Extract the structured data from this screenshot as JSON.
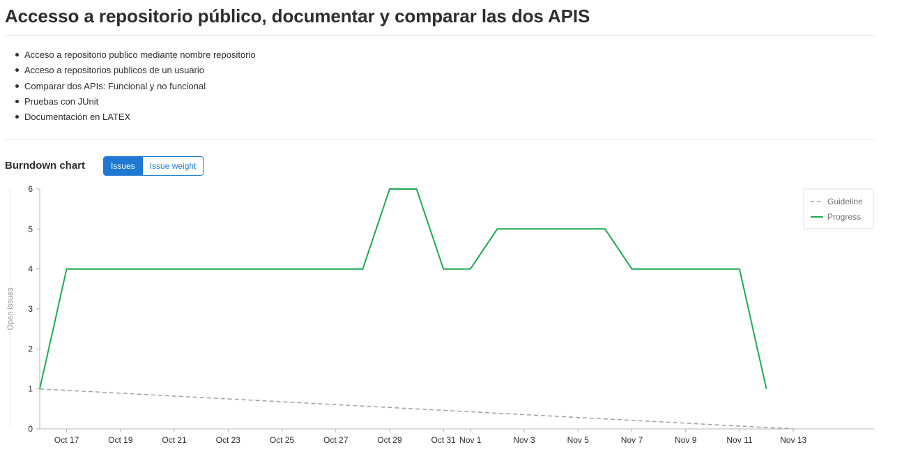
{
  "page": {
    "title": "Accesso a repositorio público, documentar y comparar las dos APIS"
  },
  "description": {
    "items": [
      "Acceso a repositorio publico mediante nombre repositorio",
      "Acceso a repositorios publicos de un usuario",
      "Comparar dos APIs: Funcional y no funcional",
      "Pruebas con JUnit",
      "Documentación en LATEX"
    ]
  },
  "burndown": {
    "heading": "Burndown chart",
    "toggle": {
      "issues_label": "Issues",
      "weight_label": "Issue weight",
      "selected": "Issues"
    }
  },
  "colors": {
    "accent": "#1f78d1",
    "progress": "#1aaa55",
    "guideline": "#a0a0a0",
    "text": "#2e2e2e"
  },
  "chart_data": {
    "type": "line",
    "title": "",
    "xlabel": "",
    "ylabel": "Open issues",
    "ylim": [
      0,
      6
    ],
    "y_ticks": [
      0,
      1,
      2,
      3,
      4,
      5,
      6
    ],
    "x_range": [
      "2017-10-16",
      "2017-11-16"
    ],
    "x_tick_dates": [
      "2017-10-17",
      "2017-10-19",
      "2017-10-21",
      "2017-10-23",
      "2017-10-25",
      "2017-10-27",
      "2017-10-29",
      "2017-10-31",
      "2017-11-01",
      "2017-11-03",
      "2017-11-05",
      "2017-11-07",
      "2017-11-09",
      "2017-11-11",
      "2017-11-13"
    ],
    "x_tick_labels": [
      "Oct 17",
      "Oct 19",
      "Oct 21",
      "Oct 23",
      "Oct 25",
      "Oct 27",
      "Oct 29",
      "Oct 31",
      "Nov 1",
      "Nov 3",
      "Nov 5",
      "Nov 7",
      "Nov 9",
      "Nov 11",
      "Nov 13"
    ],
    "grid": false,
    "legend_position": "top-right",
    "series": [
      {
        "name": "Guideline",
        "style": "dashed",
        "color": "#a0a0a0",
        "x": [
          "2017-10-16",
          "2017-11-13"
        ],
        "y": [
          1,
          0
        ]
      },
      {
        "name": "Progress",
        "style": "solid",
        "color": "#1aaa55",
        "x": [
          "2017-10-16",
          "2017-10-17",
          "2017-10-28",
          "2017-10-29",
          "2017-10-30",
          "2017-10-31",
          "2017-11-01",
          "2017-11-02",
          "2017-11-06",
          "2017-11-07",
          "2017-11-11",
          "2017-11-12"
        ],
        "y": [
          1,
          4,
          4,
          6,
          6,
          4,
          4,
          5,
          5,
          4,
          4,
          1
        ]
      }
    ]
  }
}
